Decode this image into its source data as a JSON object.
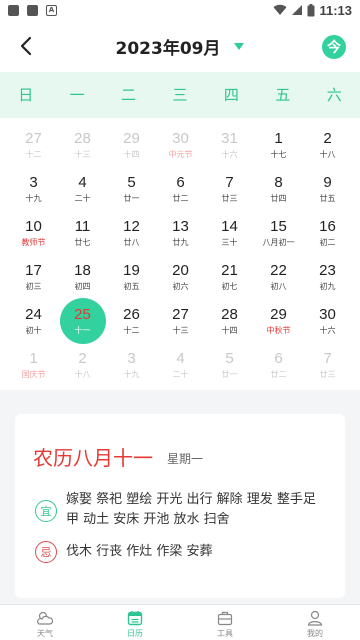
{
  "status_bar": {
    "time": "11:13"
  },
  "header": {
    "title": "2023年09月",
    "today_label": "今"
  },
  "weekdays": [
    "日",
    "一",
    "二",
    "三",
    "四",
    "五",
    "六"
  ],
  "calendar": {
    "rows": [
      [
        {
          "day": "27",
          "sub": "十二",
          "other": true
        },
        {
          "day": "28",
          "sub": "十三",
          "other": true
        },
        {
          "day": "29",
          "sub": "十四",
          "other": true
        },
        {
          "day": "30",
          "sub": "中元节",
          "other": true,
          "red": true
        },
        {
          "day": "31",
          "sub": "十六",
          "other": true
        },
        {
          "day": "1",
          "sub": "十七"
        },
        {
          "day": "2",
          "sub": "十八"
        }
      ],
      [
        {
          "day": "3",
          "sub": "十九"
        },
        {
          "day": "4",
          "sub": "二十"
        },
        {
          "day": "5",
          "sub": "廿一"
        },
        {
          "day": "6",
          "sub": "廿二"
        },
        {
          "day": "7",
          "sub": "廿三"
        },
        {
          "day": "8",
          "sub": "廿四"
        },
        {
          "day": "9",
          "sub": "廿五"
        }
      ],
      [
        {
          "day": "10",
          "sub": "教师节",
          "red": true
        },
        {
          "day": "11",
          "sub": "廿七"
        },
        {
          "day": "12",
          "sub": "廿八"
        },
        {
          "day": "13",
          "sub": "廿九"
        },
        {
          "day": "14",
          "sub": "三十"
        },
        {
          "day": "15",
          "sub": "八月初一"
        },
        {
          "day": "16",
          "sub": "初二"
        }
      ],
      [
        {
          "day": "17",
          "sub": "初三"
        },
        {
          "day": "18",
          "sub": "初四"
        },
        {
          "day": "19",
          "sub": "初五"
        },
        {
          "day": "20",
          "sub": "初六"
        },
        {
          "day": "21",
          "sub": "初七"
        },
        {
          "day": "22",
          "sub": "初八"
        },
        {
          "day": "23",
          "sub": "初九"
        }
      ],
      [
        {
          "day": "24",
          "sub": "初十"
        },
        {
          "day": "25",
          "sub": "十一",
          "selected": true
        },
        {
          "day": "26",
          "sub": "十二"
        },
        {
          "day": "27",
          "sub": "十三"
        },
        {
          "day": "28",
          "sub": "十四"
        },
        {
          "day": "29",
          "sub": "中秋节",
          "red": true
        },
        {
          "day": "30",
          "sub": "十六"
        }
      ],
      [
        {
          "day": "1",
          "sub": "国庆节",
          "other": true,
          "red": true
        },
        {
          "day": "2",
          "sub": "十八",
          "other": true
        },
        {
          "day": "3",
          "sub": "十九",
          "other": true
        },
        {
          "day": "4",
          "sub": "二十",
          "other": true
        },
        {
          "day": "5",
          "sub": "廿一",
          "other": true
        },
        {
          "day": "6",
          "sub": "廿二",
          "other": true
        },
        {
          "day": "7",
          "sub": "廿三",
          "other": true
        }
      ]
    ]
  },
  "almanac": {
    "lunar_date": "农历八月十一",
    "weekday": "星期一",
    "yi_label": "宜",
    "yi_text": "嫁娶 祭祀 塑绘 开光 出行 解除 理发 整手足甲 动土 安床 开池 放水 扫舍",
    "ji_label": "忌",
    "ji_text": "伐木 行丧 作灶 作梁 安葬"
  },
  "tabs": [
    {
      "label": "天气",
      "icon": "weather-icon",
      "active": false
    },
    {
      "label": "日历",
      "icon": "calendar-icon",
      "active": true
    },
    {
      "label": "工具",
      "icon": "toolbox-icon",
      "active": false
    },
    {
      "label": "我的",
      "icon": "user-icon",
      "active": false
    }
  ],
  "colors": {
    "accent": "#33d19d",
    "holiday_red": "#e53935",
    "week_bar": "#e6f8f0"
  }
}
